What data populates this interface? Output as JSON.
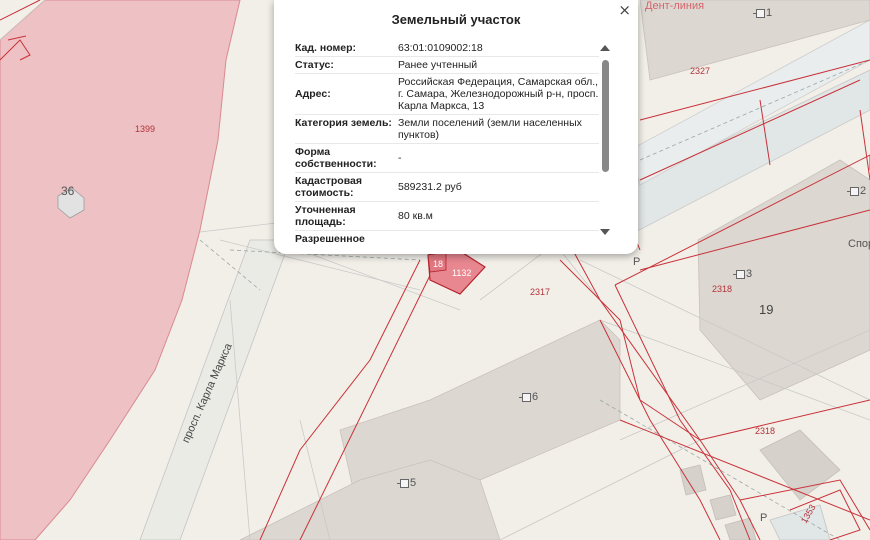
{
  "popup": {
    "title": "Земельный участок",
    "close_symbol": "×",
    "rows": [
      {
        "label": "Кад. номер:",
        "value": "63:01:0109002:18"
      },
      {
        "label": "Статус:",
        "value": "Ранее учтенный"
      },
      {
        "label": "Адрес:",
        "value": "Российская Федерация, Самарская обл., г. Самара, Железнодорожный р-н, просп. Карла Маркса, 13"
      },
      {
        "label": "Категория земель:",
        "value": "Земли поселений (земли населенных пунктов)"
      },
      {
        "label": "Форма собственности:",
        "value": "-"
      },
      {
        "label": "Кадастровая стоимость:",
        "value": "589231.2 руб"
      },
      {
        "label": "Уточненная площадь:",
        "value": "80 кв.м"
      },
      {
        "label": "Разрешенное",
        "value": ""
      }
    ]
  },
  "map": {
    "labels": {
      "street": "просп. Карла Маркса",
      "parcel_1399": "1399",
      "parcel_2327": "2327",
      "parcel_2317": "2317",
      "parcel_2318a": "2318",
      "parcel_2318b": "2318",
      "parcel_1353": "1353",
      "parcel_18": "18",
      "parcel_1132": "1132",
      "house_36": "36",
      "house_1": "1",
      "house_2": "2",
      "house_3": "3",
      "house_6": "6",
      "house_5": "5",
      "block_19": "19",
      "poi_dent": "Дент-линия",
      "poi_sport": "Спор",
      "parking_p1": "P",
      "parking_p2": "P"
    }
  },
  "colors": {
    "pink_area": "#eec1c4",
    "parcel_line": "#c8323a",
    "building": "#dcd7d1",
    "road": "#e4e9e8",
    "background": "#f2efe8"
  }
}
